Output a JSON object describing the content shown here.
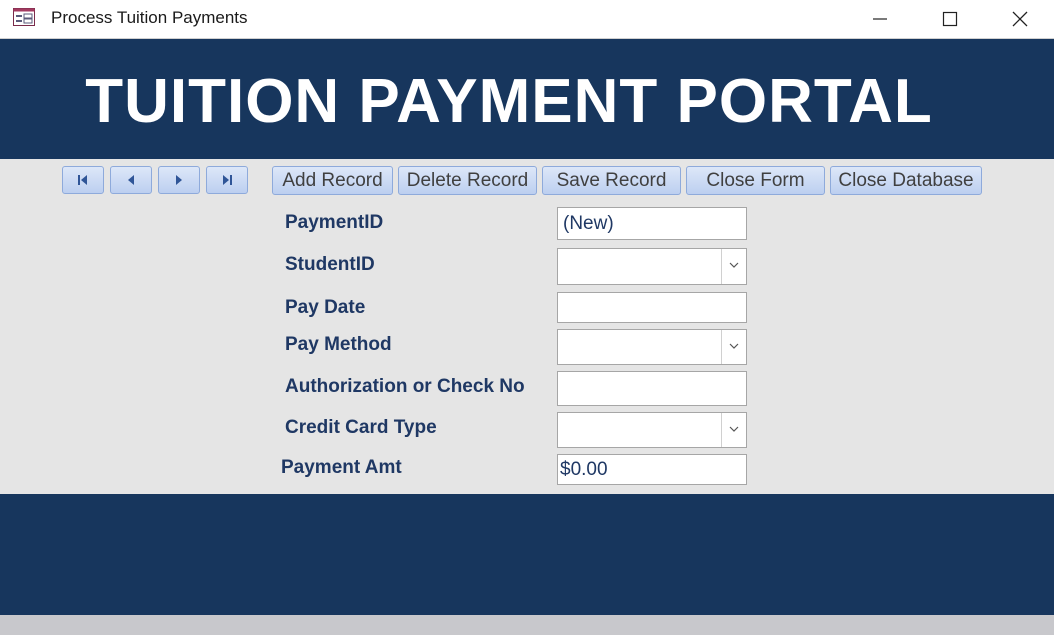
{
  "window": {
    "title": "Process Tuition Payments",
    "icon": "form-icon"
  },
  "header": {
    "title": "TUITION PAYMENT PORTAL"
  },
  "navigation": [
    {
      "name": "first-record",
      "icon": "first-record-icon"
    },
    {
      "name": "previous-record",
      "icon": "previous-record-icon"
    },
    {
      "name": "next-record",
      "icon": "next-record-icon"
    },
    {
      "name": "last-record",
      "icon": "last-record-icon"
    }
  ],
  "toolbar": {
    "add_label": "Add Record",
    "delete_label": "Delete Record",
    "save_label": "Save Record",
    "close_form_label": "Close Form",
    "close_db_label": "Close Database"
  },
  "fields": {
    "payment_id": {
      "label": "PaymentID",
      "value": "(New)"
    },
    "student_id": {
      "label": "StudentID",
      "value": ""
    },
    "pay_date": {
      "label": "Pay Date",
      "value": ""
    },
    "pay_method": {
      "label": "Pay Method",
      "value": ""
    },
    "authorization": {
      "label": "Authorization or Check No",
      "value": ""
    },
    "card_type": {
      "label": "Credit Card Type",
      "value": ""
    },
    "payment_amt": {
      "label": "Payment Amt",
      "value": "$0.00"
    }
  },
  "colors": {
    "header_band": "#17365d",
    "detail_background": "#e5e5e5",
    "label_text": "#1f3864",
    "button_fill": "#bccff0"
  }
}
